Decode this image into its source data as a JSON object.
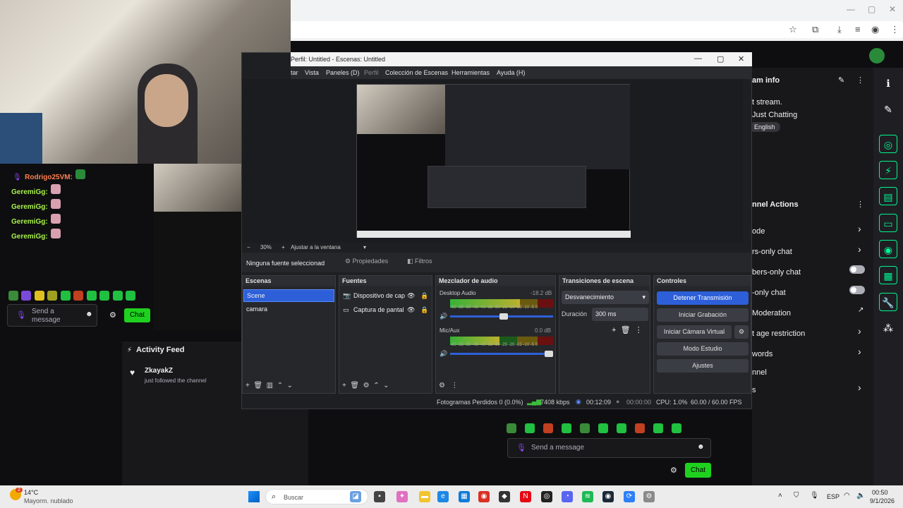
{
  "browser": {
    "window_controls": [
      "—",
      "▢",
      "✕"
    ],
    "toolbar_icons": [
      "star-icon",
      "profile-icon",
      "download-icon",
      "list-icon",
      "account-icon",
      "menu-icon"
    ]
  },
  "obs": {
    "title": "Perfil: Untitled - Escenas: Untitled",
    "menu": [
      "tar",
      "Vista",
      "Paneles (D)",
      "Perfil",
      "Colección de Escenas",
      "Herramientas",
      "Ayuda (H)"
    ],
    "zoom": "30%",
    "fit_window": "Ajustar a la ventana",
    "no_source": "Ninguna fuente seleccionad",
    "properties_btn": "Propiedades",
    "filters_btn": "Filtros",
    "scenes": {
      "title": "Escenas",
      "items": [
        "Scene",
        "camara"
      ]
    },
    "sources": {
      "title": "Fuentes",
      "items": [
        "Dispositivo de cap",
        "Captura de pantal"
      ]
    },
    "mixer": {
      "title": "Mezclador de audio",
      "channels": [
        {
          "name": "Desktop Audio",
          "db": "-18.2 dB",
          "level": 0.68
        },
        {
          "name": "Mic/Aux",
          "db": "0.0 dB",
          "level": 0.48
        }
      ],
      "scale": "-60 -55 -50 -45 -40 -35 -30 -25 -20 -15 -10 -5 0"
    },
    "transitions": {
      "title": "Transiciones de escena",
      "type": "Desvanecimiento",
      "duration_label": "Duración",
      "duration": "300 ms"
    },
    "controls": {
      "title": "Controles",
      "stop_stream": "Detener Transmisión",
      "start_record": "Iniciar Grabación",
      "virtual_cam": "Iniciar Cámara Virtual",
      "studio": "Modo Estudio",
      "settings": "Ajustes"
    },
    "status": {
      "dropped": "Fotogramas Perdidos 0 (0.0%)",
      "bitrate": "7408 kbps",
      "live_time": "00:12:09",
      "rec_time": "00:00:00",
      "cpu": "CPU: 1.0%",
      "fps": "60.00 / 60.00 FPS"
    }
  },
  "chat_left": {
    "messages": [
      {
        "user": "Rodrigo25VM:"
      },
      {
        "user": "GeremiGg:"
      },
      {
        "user": "GeremiGg:"
      },
      {
        "user": "GeremiGg:"
      },
      {
        "user": "GeremiGg:"
      }
    ],
    "placeholder_line1": "Send a",
    "placeholder_line2": "message",
    "chat_btn": "Chat"
  },
  "activity": {
    "title": "Activity Feed",
    "user": "ZkayakZ",
    "action": "just followed the channel"
  },
  "stream_info": {
    "title": "am info",
    "stream": "t stream.",
    "category": "Just Chatting",
    "tag": "English"
  },
  "channel_actions": {
    "title": "nnel Actions",
    "items": [
      {
        "label": "ode",
        "control": "chevron"
      },
      {
        "label": "rs-only chat",
        "control": "chevron"
      },
      {
        "label": "bers-only chat",
        "control": "toggle"
      },
      {
        "label": "-only chat",
        "control": "toggle"
      },
      {
        "label": "Moderation",
        "control": "external"
      },
      {
        "label": "t age restriction",
        "control": "chevron"
      },
      {
        "label": "words",
        "control": "chevron"
      },
      {
        "label": "nnel",
        "control": "none"
      },
      {
        "label": "s",
        "control": "chevron"
      }
    ]
  },
  "chat_right": {
    "placeholder": "Send a message",
    "chat_btn": "Chat"
  },
  "taskbar": {
    "weather_temp": "14°C",
    "weather_desc": "Mayorm. nublado",
    "weather_badge": "2",
    "search": "Buscar",
    "lang": "ESP",
    "time": "00:50",
    "date": "9/1/2026"
  },
  "colors": {
    "twitch_green": "#00f593",
    "obs_blue": "#2d5fd8",
    "chat_btn": "#1fd11f"
  }
}
